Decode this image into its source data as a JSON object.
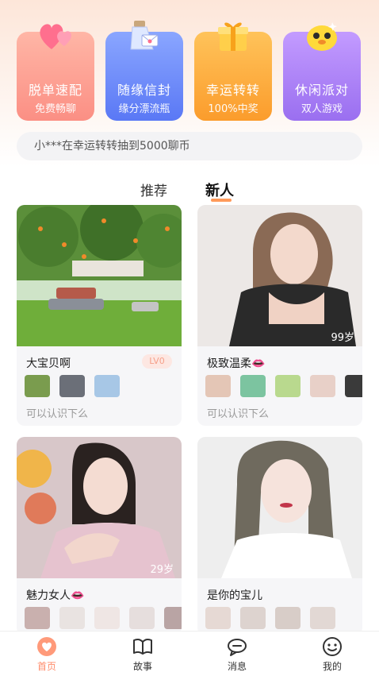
{
  "features": [
    {
      "title": "脱单速配",
      "subtitle": "免费畅聊",
      "icon": "heart-balloon-icon"
    },
    {
      "title": "随缘信封",
      "subtitle": "缘分漂流瓶",
      "icon": "bottle-letter-icon"
    },
    {
      "title": "幸运转转",
      "subtitle": "100%中奖",
      "icon": "gift-box-icon"
    },
    {
      "title": "休闲派对",
      "subtitle": "双人游戏",
      "icon": "yellow-mascot-icon"
    }
  ],
  "ticker": {
    "text": "小***在幸运转转抽到5000聊币"
  },
  "tabs": {
    "recommend": "推荐",
    "new": "新人",
    "active": "新人"
  },
  "cards": [
    {
      "name": "大宝贝啊",
      "level": "LV0",
      "age": "",
      "greeting": "可以认识下么"
    },
    {
      "name": "极致温柔👄",
      "level": "",
      "age": "99岁",
      "greeting": "可以认识下么"
    },
    {
      "name": "魅力女人👄",
      "level": "",
      "age": "29岁",
      "greeting": ""
    },
    {
      "name": "是你的宝儿",
      "level": "",
      "age": "",
      "greeting": ""
    }
  ],
  "nav": {
    "home": "首页",
    "story": "故事",
    "message": "消息",
    "mine": "我的"
  },
  "colors": {
    "accent": "#ff8b6a",
    "card1": "#fb8f84",
    "card2": "#5a78f5",
    "card3": "#fb9c2c",
    "card4": "#9a6ff0"
  }
}
